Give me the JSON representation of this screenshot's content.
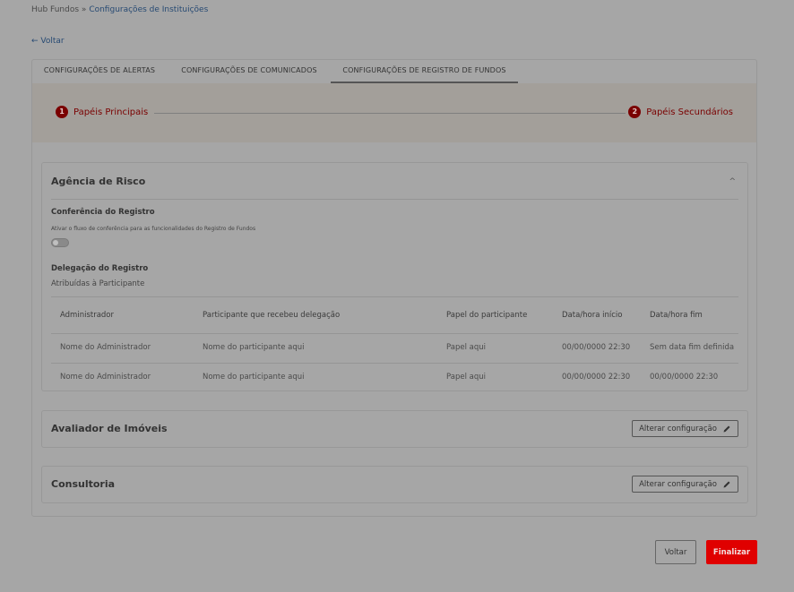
{
  "breadcrumb": {
    "root": "Hub Fundos",
    "separator": "»",
    "current": "Configurações de Instituições"
  },
  "back_link": {
    "arrow": "←",
    "label": "Voltar"
  },
  "tabs": [
    {
      "label": "CONFIGURAÇÕES DE ALERTAS"
    },
    {
      "label": "CONFIGURAÇÕES DE COMUNICADOS"
    },
    {
      "label": "CONFIGURAÇÕES DE REGISTRO DE FUNDOS",
      "active": true
    }
  ],
  "stepper": {
    "steps": [
      {
        "number": "1",
        "label": "Papéis Principais"
      },
      {
        "number": "2",
        "label": "Papéis Secundários"
      }
    ]
  },
  "agencia": {
    "title": "Agência de Risco",
    "chevron": "^",
    "conferencia_title": "Conferência do Registro",
    "conferencia_desc": "Ativar o fluxo de conferência para as funcionalidades do Registro de Fundos",
    "delegacao_title": "Delegação do Registro",
    "delegacao_sub": "Atribuídas à Participante",
    "table": {
      "headers": [
        "Administrador",
        "Participante que recebeu delegação",
        "Papel do participante",
        "Data/hora início",
        "Data/hora fim"
      ],
      "rows": [
        [
          "Nome do Administrador",
          "Nome do participante aqui",
          "Papel aqui",
          "00/00/0000 22:30",
          "Sem data fim definida"
        ],
        [
          "Nome do Administrador",
          "Nome do participante aqui",
          "Papel aqui",
          "00/00/0000 22:30",
          "00/00/0000 22:30"
        ]
      ]
    }
  },
  "avaliador": {
    "title": "Avaliador de Imóveis",
    "button": "Alterar configuração"
  },
  "consultoria": {
    "title": "Consultoria",
    "button": "Alterar configuração"
  },
  "footer": {
    "voltar": "Voltar",
    "finalizar": "Finalizar"
  },
  "colors": {
    "accent_red": "#e00000",
    "link_blue": "#274a73"
  },
  "icons": [
    "arrow-left-icon",
    "chevron-up-icon",
    "pencil-icon"
  ]
}
